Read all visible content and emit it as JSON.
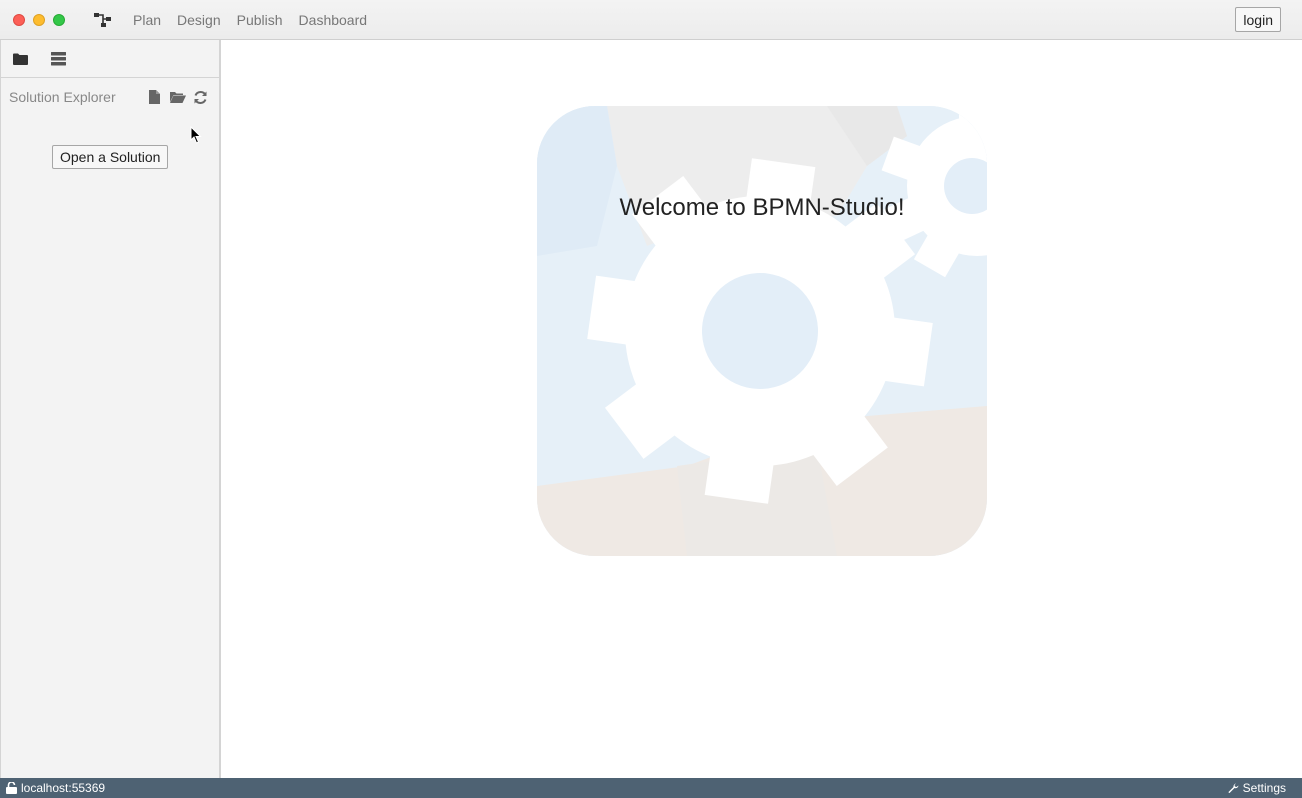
{
  "nav": {
    "items": [
      "Plan",
      "Design",
      "Publish",
      "Dashboard"
    ]
  },
  "header": {
    "login_label": "login"
  },
  "sidebar": {
    "explorer_title": "Solution Explorer",
    "open_solution_label": "Open a Solution",
    "tab_icons": [
      "folder-icon",
      "list-icon"
    ],
    "action_icons": [
      "file-icon",
      "folder-open-icon",
      "refresh-icon"
    ]
  },
  "main": {
    "welcome_text": "Welcome to BPMN-Studio!"
  },
  "status": {
    "server": "localhost:55369",
    "settings_label": "Settings"
  },
  "colors": {
    "statusbar": "#4e6273",
    "titlebar": "#ececec",
    "sidebar": "#f3f3f3"
  }
}
